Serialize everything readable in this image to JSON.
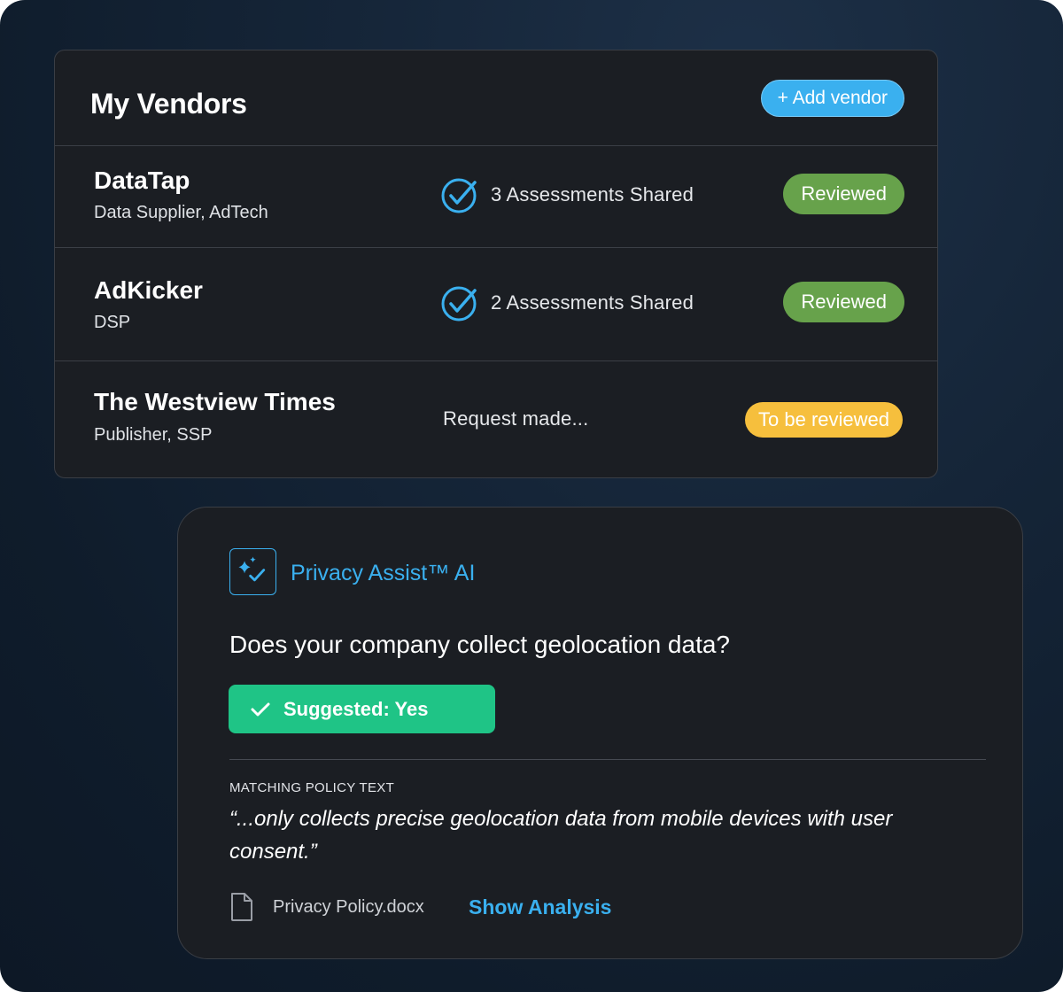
{
  "vendors": {
    "title": "My Vendors",
    "add_button_label": "+ Add vendor",
    "rows": [
      {
        "name": "DataTap",
        "type": "Data Supplier, AdTech",
        "status": "3 Assessments Shared",
        "status_icon": "check-circle-icon",
        "badge": "Reviewed",
        "badge_color": "#67a24b"
      },
      {
        "name": "AdKicker",
        "type": "DSP",
        "status": "2 Assessments Shared",
        "status_icon": "check-circle-icon",
        "badge": "Reviewed",
        "badge_color": "#67a24b"
      },
      {
        "name": "The Westview Times",
        "type": "Publisher, SSP",
        "status": "Request made...",
        "badge": "To be reviewed",
        "badge_color": "#f6bf3d"
      }
    ]
  },
  "assist": {
    "icon": "sparkle-check-icon",
    "title": "Privacy Assist™ AI",
    "question": "Does your company collect geolocation data?",
    "suggestion": "Suggested: Yes",
    "suggestion_color": "#1fc486",
    "matching_label": "MATCHING POLICY TEXT",
    "quote": "“...only collects precise geolocation data from mobile devices with user consent.”",
    "document_icon": "document-icon",
    "document_name": "Privacy Policy.docx",
    "show_analysis_label": "Show Analysis"
  },
  "colors": {
    "accent": "#3ab0ef",
    "card_bg": "#1b1e23",
    "page_bg": "#152538"
  }
}
